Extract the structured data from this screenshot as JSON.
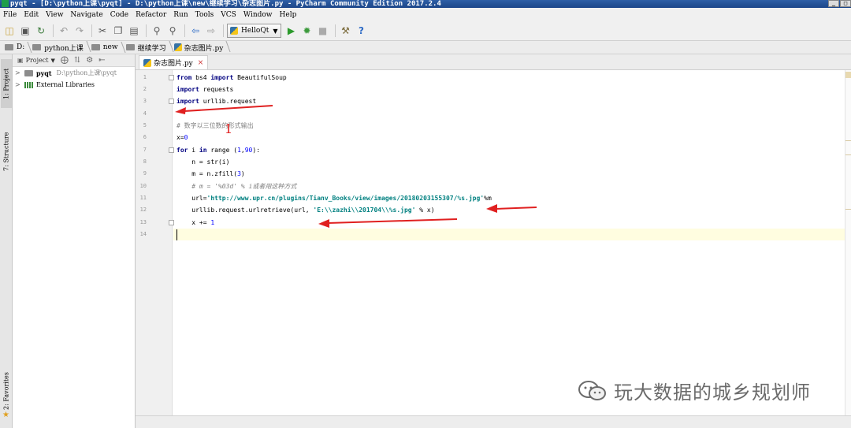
{
  "window": {
    "title": "pyqt - [D:\\python上课\\pyqt] - D:\\python上课\\new\\继续学习\\杂志图片.py - PyCharm Community Edition 2017.2.4"
  },
  "menu": [
    "File",
    "Edit",
    "View",
    "Navigate",
    "Code",
    "Refactor",
    "Run",
    "Tools",
    "VCS",
    "Window",
    "Help"
  ],
  "toolbar": {
    "run_config": "HelloQt",
    "icons": [
      "open-folder-icon",
      "save-icon",
      "sync-icon",
      "undo-icon",
      "redo-icon",
      "cut-icon",
      "copy-icon",
      "paste-icon",
      "find-icon",
      "replace-icon",
      "back-icon",
      "forward-icon",
      "run-icon",
      "debug-icon",
      "stop-icon",
      "settings-icon",
      "help-icon"
    ]
  },
  "breadcrumb": [
    "D:",
    "python上课",
    "new",
    "继续学习",
    "杂志图片.py"
  ],
  "side_tabs": {
    "project": "1: Project",
    "structure": "7: Structure",
    "favorites": "2: Favorites"
  },
  "project_panel": {
    "header": "Project",
    "tree": [
      {
        "name": "pyqt",
        "path": "D:\\python上课\\pyqt"
      },
      {
        "name": "External Libraries",
        "path": ""
      }
    ]
  },
  "editor": {
    "tab": "杂志图片.py",
    "line_numbers": [
      "1",
      "2",
      "3",
      "4",
      "5",
      "6",
      "7",
      "8",
      "9",
      "10",
      "11",
      "12",
      "13",
      "14"
    ],
    "code": {
      "l1_kw1": "from",
      "l1_mod": " bs4 ",
      "l1_kw2": "import",
      "l1_rest": " BeautifulSoup",
      "l2_kw": "import",
      "l2_rest": " requests",
      "l3_kw": "import",
      "l3_rest": " urllib.request",
      "l5": "# 数字以三位数的形式输出",
      "l6_a": "x=",
      "l6_num": "0",
      "l7_kw1": "for",
      "l7_a": " i ",
      "l7_kw2": "in",
      "l7_b": " range (",
      "l7_n1": "1",
      "l7_c": ",",
      "l7_n2": "90",
      "l7_d": "):",
      "l8_a": "    n = str(i)",
      "l9_a": "    m = n.zfill(",
      "l9_num": "3",
      "l9_b": ")",
      "l10": "    # m = '%03d' % i或者用这种方式",
      "l11_a": "    url=",
      "l11_str": "'http://www.upr.cn/plugins/Tianv_Books/view/images/20180203155307/%s.jpg'",
      "l11_b": "%m",
      "l12_a": "    urllib.request.urlretrieve(url, ",
      "l12_str": "'E:\\\\zazhi\\\\201704\\\\%s.jpg'",
      "l12_b": " % x)",
      "l13_a": "    x += ",
      "l13_num": "1"
    }
  },
  "annotation": {
    "number": "1"
  },
  "watermark": "玩大数据的城乡规划师",
  "colors": {
    "keyword": "#000080",
    "string": "#008080",
    "number": "#0000ff",
    "comment": "#808080",
    "arrow": "#e02020"
  }
}
